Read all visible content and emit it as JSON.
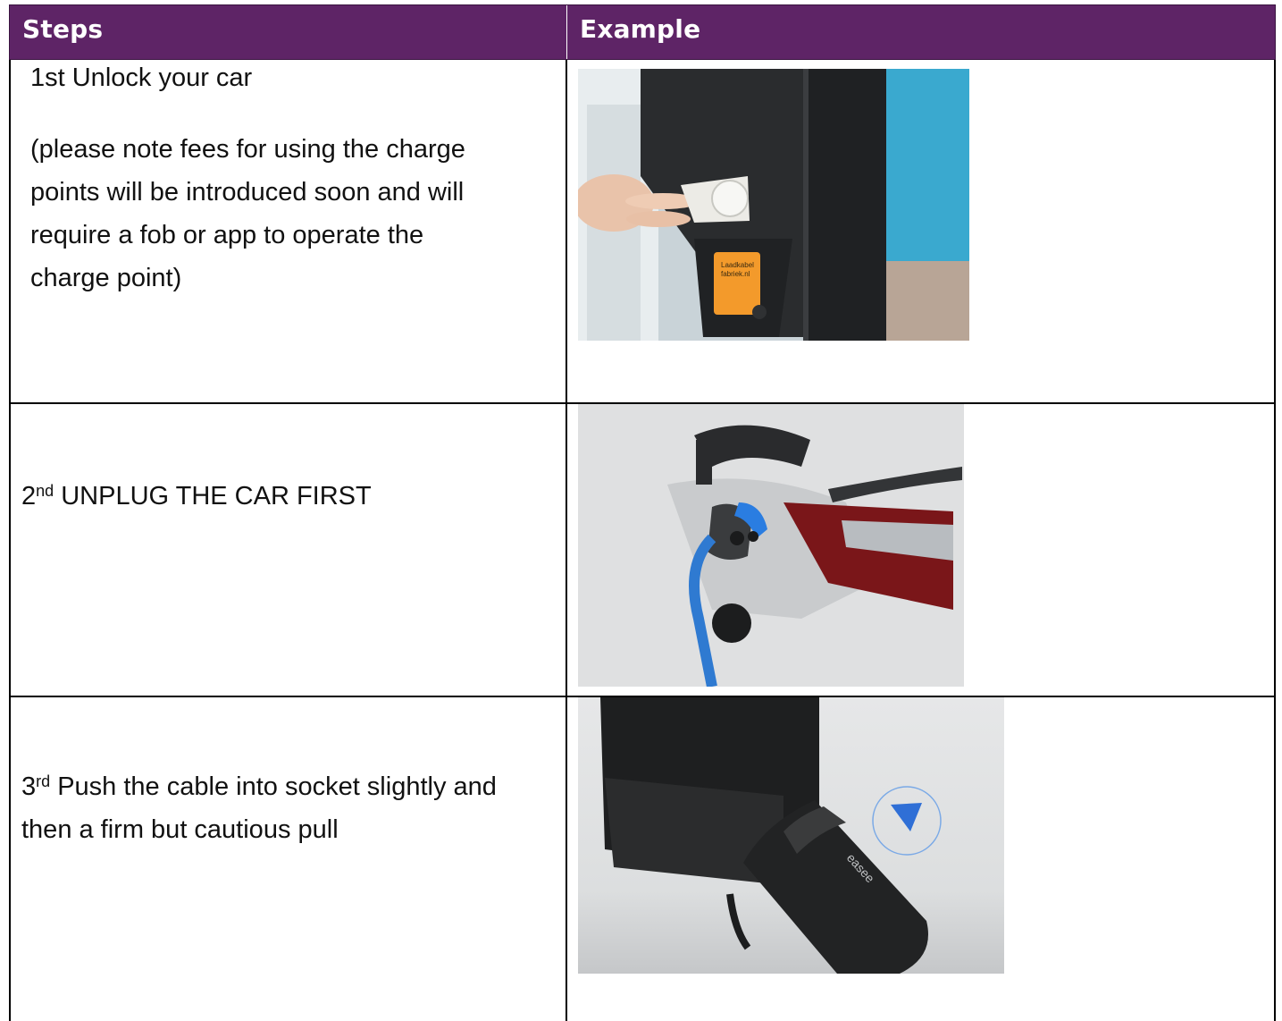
{
  "table": {
    "headers": {
      "steps": "Steps",
      "example": "Example"
    },
    "rows": [
      {
        "step_line": "1st Unlock your car",
        "note": "(please note fees for using the charge points will be introduced soon and will require a fob or app to operate the charge point)",
        "note_lines": [
          "(please note fees for using the charge",
          "points will be introduced soon and will",
          "require a fob or app to operate the",
          "charge point)"
        ],
        "image": {
          "sticker_lines": [
            "Laadkabel",
            "fabriek.nl"
          ]
        }
      },
      {
        "step_number": "2",
        "step_suffix": "nd",
        "step_text": " UNPLUG THE CAR FIRST"
      },
      {
        "step_number": "3",
        "step_suffix": "rd",
        "step_text_line1": " Push the cable into socket slightly and",
        "step_text_line2": "then a firm but cautious pull",
        "image": {
          "brand": "easee"
        }
      }
    ]
  },
  "colors": {
    "header_bg": "#5e2466",
    "header_text": "#ffffff",
    "grid": "#000000"
  }
}
